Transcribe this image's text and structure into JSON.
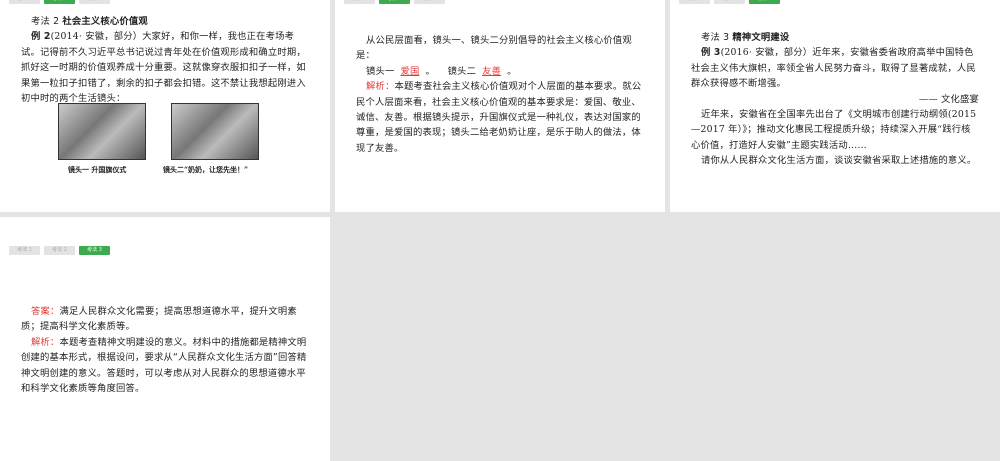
{
  "tabs": [
    "考法 1",
    "考法 2",
    "考法 3"
  ],
  "slide1": {
    "title_prefix": "考法 2 ",
    "title": "社会主义核心价值观",
    "ex_label": "例 2",
    "text": "(2014· 安徽，部分）大家好，和你一样，我也正在考场考试。记得前不久习近平总书记说过青年处在价值观形成和确立时期，抓好这一时期的价值观养成十分重要。这就像穿衣服扣扣子一样，如果第一粒扣子扣错了，剩余的扣子都会扣错。这不禁让我想起刚进入初中时的两个生活镜头：",
    "cap1": "镜头一 升国旗仪式",
    "cap2": "镜头二“奶奶，让您先坐！”"
  },
  "slide2": {
    "q": "从公民层面看，镜头一、镜头二分别倡导的社会主义核心价值观是：",
    "l1": "镜头一",
    "a1": "爱国",
    "l2": "镜头二",
    "a2": "友善",
    "period": "。",
    "an_label": "解析：",
    "an": "本题考查社会主义核心价值观对个人层面的基本要求。就公民个人层面来看，社会主义核心价值观的基本要求是：爱国、敬业、诚信、友善。根据镜头提示，升国旗仪式是一种礼仪，表达对国家的尊重，是爱国的表现；镜头二给老奶奶让座，是乐于助人的做法，体现了友善。"
  },
  "slide3": {
    "title_prefix": "考法 3 ",
    "title": "精神文明建设",
    "ex_label": "例 3",
    "p1": "(2016· 安徽，部分）近年来，安徽省委省政府高举中国特色社会主义伟大旗帜，率领全省人民努力奋斗，取得了显著成就，人民群众获得感不断增强。",
    "src": "—— 文化盛宴",
    "p2": "近年来，安徽省在全国率先出台了《文明城市创建行动纲领(2015—2017 年）》；推动文化惠民工程提质升级；持续深入开展“践行核心价值，打造好人安徽”主题实践活动……",
    "p3": "请你从人民群众文化生活方面，谈谈安徽省采取上述措施的意义。"
  },
  "slide4": {
    "ans_label": "答案：",
    "ans": "满足人民群众文化需要；提高思想道德水平，提升文明素质；提高科学文化素质等。",
    "an_label": "解析：",
    "an": "本题考查精神文明建设的意义。材料中的措施都是精神文明创建的基本形式，根据设问，要求从“人民群众文化生活方面”回答精神文明创建的意义。答题时，可以考虑从对人民群众的思想道德水平和科学文化素质等角度回答。"
  }
}
